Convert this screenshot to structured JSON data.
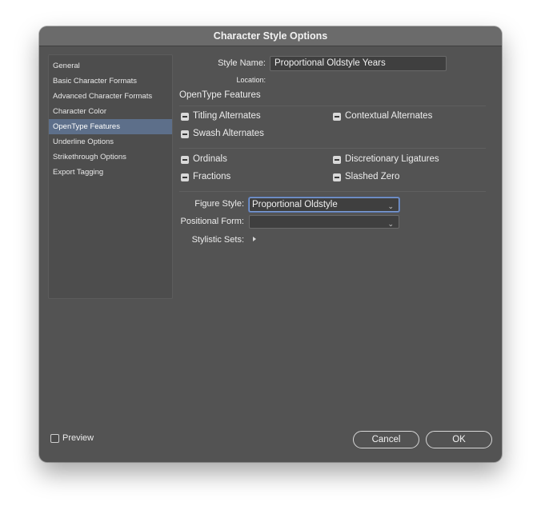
{
  "window": {
    "title": "Character Style Options"
  },
  "sidebar": {
    "items": [
      {
        "label": "General"
      },
      {
        "label": "Basic Character Formats"
      },
      {
        "label": "Advanced Character Formats"
      },
      {
        "label": "Character Color"
      },
      {
        "label": "OpenType Features",
        "selected": true
      },
      {
        "label": "Underline Options"
      },
      {
        "label": "Strikethrough Options"
      },
      {
        "label": "Export Tagging"
      }
    ]
  },
  "main": {
    "style_name_label": "Style Name:",
    "style_name_value": "Proportional Oldstyle Years",
    "location_label": "Location:",
    "section_title": "OpenType Features",
    "features": {
      "titling_alternates": "Titling Alternates",
      "contextual_alternates": "Contextual Alternates",
      "swash_alternates": "Swash Alternates",
      "ordinals": "Ordinals",
      "discretionary_ligatures": "Discretionary Ligatures",
      "fractions": "Fractions",
      "slashed_zero": "Slashed Zero"
    },
    "figure_style_label": "Figure Style:",
    "figure_style_value": "Proportional Oldstyle",
    "positional_form_label": "Positional Form:",
    "positional_form_value": "",
    "stylistic_sets_label": "Stylistic Sets:"
  },
  "footer": {
    "preview_label": "Preview",
    "cancel_label": "Cancel",
    "ok_label": "OK"
  },
  "colors": {
    "dialog_bg": "#535353",
    "titlebar_bg": "#6b6b6b",
    "selected_item": "#5d6f8a",
    "focus_ring": "#7d9bd1"
  }
}
